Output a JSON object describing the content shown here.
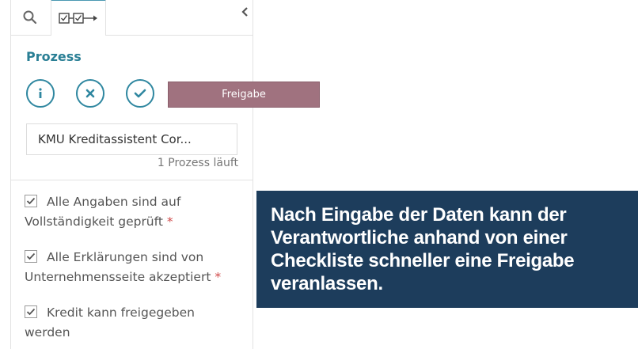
{
  "process": {
    "title": "Prozess",
    "status": "Freigabe",
    "select_value": "KMU Kreditassistent Cor...",
    "count_text": "1 Prozess läuft"
  },
  "checklist": [
    {
      "label_line1": "Alle Angaben sind auf",
      "label_line2": "Vollständigkeit geprüft",
      "required": "*"
    },
    {
      "label_line1": "Alle Erklärungen sind von",
      "label_line2": "Unternehmensseite akzeptiert",
      "required": "*"
    },
    {
      "label_line1": "Kredit kann freigegeben",
      "label_line2": "werden",
      "required": ""
    }
  ],
  "callout": {
    "text": "Nach Eingabe der Daten kann der Verantwortliche anhand von einer Checkliste schneller eine Freigabe veranlassen."
  },
  "icons": {
    "search_tab": "search-icon",
    "process_tab": "process-checklist-icon",
    "collapse": "chevron-left-icon",
    "info": "info-icon",
    "cancel": "close-icon",
    "confirm": "check-icon"
  },
  "colors": {
    "accent": "#2f87a0",
    "status_bg": "#a0727f",
    "callout_bg": "#1d3d5c",
    "required": "#d04a4a"
  }
}
